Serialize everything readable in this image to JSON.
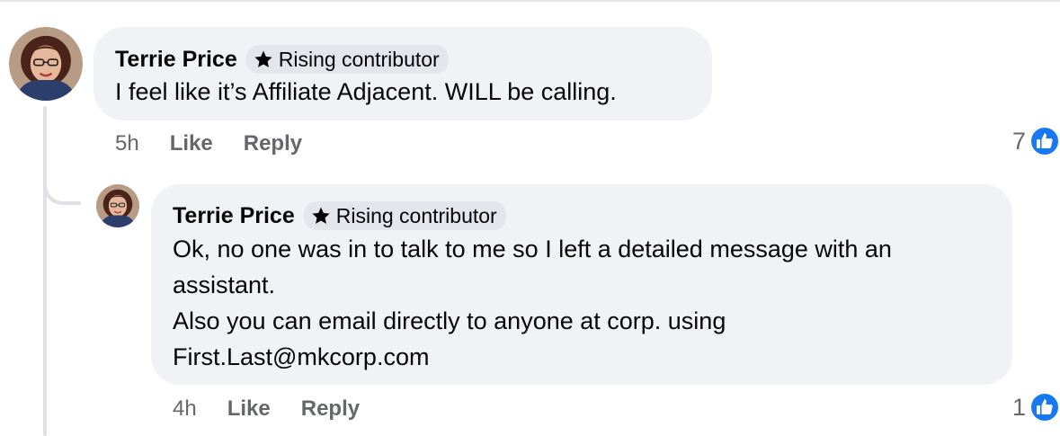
{
  "comments": [
    {
      "author": "Terrie Price",
      "badge": "Rising contributor",
      "lines": [
        "I feel like it’s Affiliate Adjacent. WILL be calling."
      ],
      "time": "5h",
      "like_label": "Like",
      "reply_label": "Reply",
      "reaction_count": "7"
    },
    {
      "author": "Terrie Price",
      "badge": "Rising contributor",
      "lines": [
        "Ok, no one was in to talk to me so I left a detailed message with an",
        "assistant.",
        "Also you can email directly to anyone at corp. using",
        "First.Last@mkcorp.com"
      ],
      "time": "4h",
      "like_label": "Like",
      "reply_label": "Reply",
      "reaction_count": "1"
    }
  ],
  "icons": {
    "badge": "star-icon",
    "reaction": "like-thumb-icon"
  },
  "colors": {
    "bubble": "#f0f2f5",
    "badge_bg": "#e4e6eb",
    "meta_text": "#65676b",
    "like_blue": "#1877f2",
    "thread_line": "#dfe1e5"
  }
}
